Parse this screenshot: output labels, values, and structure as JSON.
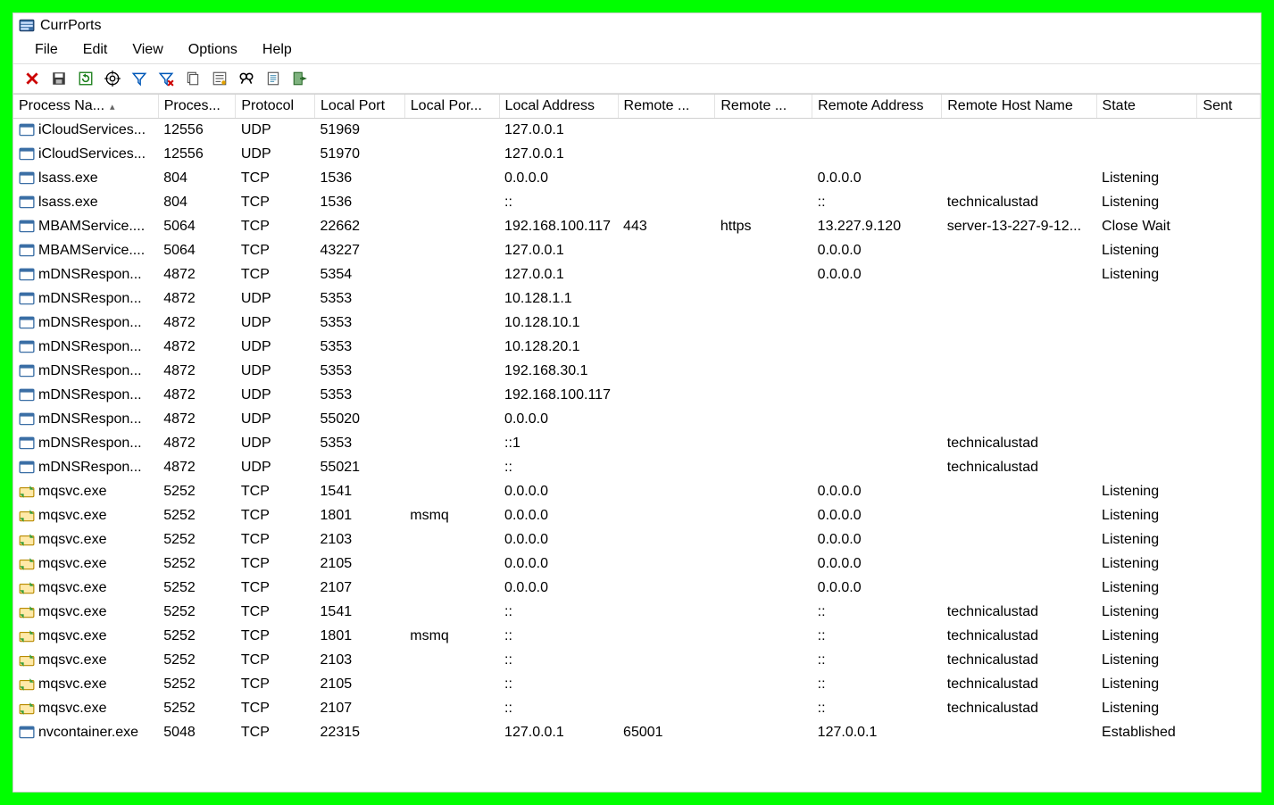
{
  "title": "CurrPorts",
  "menu": {
    "items": [
      "File",
      "Edit",
      "View",
      "Options",
      "Help"
    ]
  },
  "toolbar": {
    "buttons": [
      {
        "name": "close-icon",
        "title": "Close Selected"
      },
      {
        "name": "save-icon",
        "title": "Save"
      },
      {
        "name": "refresh-icon",
        "title": "Refresh"
      },
      {
        "name": "target-icon",
        "title": "Auto Refresh"
      },
      {
        "name": "filter-icon",
        "title": "Filter"
      },
      {
        "name": "filter-clear-icon",
        "title": "Clear Filters"
      },
      {
        "name": "copy-icon",
        "title": "Copy"
      },
      {
        "name": "properties-icon",
        "title": "Properties"
      },
      {
        "name": "find-icon",
        "title": "Find"
      },
      {
        "name": "html-report-icon",
        "title": "HTML Report"
      },
      {
        "name": "exit-icon",
        "title": "Exit"
      }
    ]
  },
  "columns": [
    {
      "key": "proc",
      "label": "Process Na...",
      "cls": "c-proc",
      "sort": true
    },
    {
      "key": "pid",
      "label": "Proces...",
      "cls": "c-pid"
    },
    {
      "key": "proto",
      "label": "Protocol",
      "cls": "c-proto"
    },
    {
      "key": "lport",
      "label": "Local Port",
      "cls": "c-lport"
    },
    {
      "key": "lportn",
      "label": "Local Por...",
      "cls": "c-lportn"
    },
    {
      "key": "laddr",
      "label": "Local Address",
      "cls": "c-laddr"
    },
    {
      "key": "rport",
      "label": "Remote ...",
      "cls": "c-rport"
    },
    {
      "key": "rportn",
      "label": "Remote ...",
      "cls": "c-rportn"
    },
    {
      "key": "raddr",
      "label": "Remote Address",
      "cls": "c-raddr"
    },
    {
      "key": "rhost",
      "label": "Remote Host Name",
      "cls": "c-rhost"
    },
    {
      "key": "state",
      "label": "State",
      "cls": "c-state"
    },
    {
      "key": "sent",
      "label": "Sent",
      "cls": "c-sent"
    }
  ],
  "rows": [
    {
      "icon": "app",
      "proc": "iCloudServices...",
      "pid": "12556",
      "proto": "UDP",
      "lport": "51969",
      "lportn": "",
      "laddr": "127.0.0.1",
      "rport": "",
      "rportn": "",
      "raddr": "",
      "rhost": "",
      "state": "",
      "sent": ""
    },
    {
      "icon": "app",
      "proc": "iCloudServices...",
      "pid": "12556",
      "proto": "UDP",
      "lport": "51970",
      "lportn": "",
      "laddr": "127.0.0.1",
      "rport": "",
      "rportn": "",
      "raddr": "",
      "rhost": "",
      "state": "",
      "sent": ""
    },
    {
      "icon": "app",
      "proc": "lsass.exe",
      "pid": "804",
      "proto": "TCP",
      "lport": "1536",
      "lportn": "",
      "laddr": "0.0.0.0",
      "rport": "",
      "rportn": "",
      "raddr": "0.0.0.0",
      "rhost": "",
      "state": "Listening",
      "sent": ""
    },
    {
      "icon": "app",
      "proc": "lsass.exe",
      "pid": "804",
      "proto": "TCP",
      "lport": "1536",
      "lportn": "",
      "laddr": "::",
      "rport": "",
      "rportn": "",
      "raddr": "::",
      "rhost": "technicalustad",
      "state": "Listening",
      "sent": ""
    },
    {
      "icon": "app",
      "proc": "MBAMService....",
      "pid": "5064",
      "proto": "TCP",
      "lport": "22662",
      "lportn": "",
      "laddr": "192.168.100.117",
      "rport": "443",
      "rportn": "https",
      "raddr": "13.227.9.120",
      "rhost": "server-13-227-9-12...",
      "state": "Close Wait",
      "sent": ""
    },
    {
      "icon": "app",
      "proc": "MBAMService....",
      "pid": "5064",
      "proto": "TCP",
      "lport": "43227",
      "lportn": "",
      "laddr": "127.0.0.1",
      "rport": "",
      "rportn": "",
      "raddr": "0.0.0.0",
      "rhost": "",
      "state": "Listening",
      "sent": ""
    },
    {
      "icon": "app",
      "proc": "mDNSRespon...",
      "pid": "4872",
      "proto": "TCP",
      "lport": "5354",
      "lportn": "",
      "laddr": "127.0.0.1",
      "rport": "",
      "rportn": "",
      "raddr": "0.0.0.0",
      "rhost": "",
      "state": "Listening",
      "sent": ""
    },
    {
      "icon": "app",
      "proc": "mDNSRespon...",
      "pid": "4872",
      "proto": "UDP",
      "lport": "5353",
      "lportn": "",
      "laddr": "10.128.1.1",
      "rport": "",
      "rportn": "",
      "raddr": "",
      "rhost": "",
      "state": "",
      "sent": ""
    },
    {
      "icon": "app",
      "proc": "mDNSRespon...",
      "pid": "4872",
      "proto": "UDP",
      "lport": "5353",
      "lportn": "",
      "laddr": "10.128.10.1",
      "rport": "",
      "rportn": "",
      "raddr": "",
      "rhost": "",
      "state": "",
      "sent": ""
    },
    {
      "icon": "app",
      "proc": "mDNSRespon...",
      "pid": "4872",
      "proto": "UDP",
      "lport": "5353",
      "lportn": "",
      "laddr": "10.128.20.1",
      "rport": "",
      "rportn": "",
      "raddr": "",
      "rhost": "",
      "state": "",
      "sent": ""
    },
    {
      "icon": "app",
      "proc": "mDNSRespon...",
      "pid": "4872",
      "proto": "UDP",
      "lport": "5353",
      "lportn": "",
      "laddr": "192.168.30.1",
      "rport": "",
      "rportn": "",
      "raddr": "",
      "rhost": "",
      "state": "",
      "sent": ""
    },
    {
      "icon": "app",
      "proc": "mDNSRespon...",
      "pid": "4872",
      "proto": "UDP",
      "lport": "5353",
      "lportn": "",
      "laddr": "192.168.100.117",
      "rport": "",
      "rportn": "",
      "raddr": "",
      "rhost": "",
      "state": "",
      "sent": ""
    },
    {
      "icon": "app",
      "proc": "mDNSRespon...",
      "pid": "4872",
      "proto": "UDP",
      "lport": "55020",
      "lportn": "",
      "laddr": "0.0.0.0",
      "rport": "",
      "rportn": "",
      "raddr": "",
      "rhost": "",
      "state": "",
      "sent": ""
    },
    {
      "icon": "app",
      "proc": "mDNSRespon...",
      "pid": "4872",
      "proto": "UDP",
      "lport": "5353",
      "lportn": "",
      "laddr": "::1",
      "rport": "",
      "rportn": "",
      "raddr": "",
      "rhost": "technicalustad",
      "state": "",
      "sent": ""
    },
    {
      "icon": "app",
      "proc": "mDNSRespon...",
      "pid": "4872",
      "proto": "UDP",
      "lport": "55021",
      "lportn": "",
      "laddr": "::",
      "rport": "",
      "rportn": "",
      "raddr": "",
      "rhost": "technicalustad",
      "state": "",
      "sent": ""
    },
    {
      "icon": "svc",
      "proc": "mqsvc.exe",
      "pid": "5252",
      "proto": "TCP",
      "lport": "1541",
      "lportn": "",
      "laddr": "0.0.0.0",
      "rport": "",
      "rportn": "",
      "raddr": "0.0.0.0",
      "rhost": "",
      "state": "Listening",
      "sent": ""
    },
    {
      "icon": "svc",
      "proc": "mqsvc.exe",
      "pid": "5252",
      "proto": "TCP",
      "lport": "1801",
      "lportn": "msmq",
      "laddr": "0.0.0.0",
      "rport": "",
      "rportn": "",
      "raddr": "0.0.0.0",
      "rhost": "",
      "state": "Listening",
      "sent": ""
    },
    {
      "icon": "svc",
      "proc": "mqsvc.exe",
      "pid": "5252",
      "proto": "TCP",
      "lport": "2103",
      "lportn": "",
      "laddr": "0.0.0.0",
      "rport": "",
      "rportn": "",
      "raddr": "0.0.0.0",
      "rhost": "",
      "state": "Listening",
      "sent": ""
    },
    {
      "icon": "svc",
      "proc": "mqsvc.exe",
      "pid": "5252",
      "proto": "TCP",
      "lport": "2105",
      "lportn": "",
      "laddr": "0.0.0.0",
      "rport": "",
      "rportn": "",
      "raddr": "0.0.0.0",
      "rhost": "",
      "state": "Listening",
      "sent": ""
    },
    {
      "icon": "svc",
      "proc": "mqsvc.exe",
      "pid": "5252",
      "proto": "TCP",
      "lport": "2107",
      "lportn": "",
      "laddr": "0.0.0.0",
      "rport": "",
      "rportn": "",
      "raddr": "0.0.0.0",
      "rhost": "",
      "state": "Listening",
      "sent": ""
    },
    {
      "icon": "svc",
      "proc": "mqsvc.exe",
      "pid": "5252",
      "proto": "TCP",
      "lport": "1541",
      "lportn": "",
      "laddr": "::",
      "rport": "",
      "rportn": "",
      "raddr": "::",
      "rhost": "technicalustad",
      "state": "Listening",
      "sent": ""
    },
    {
      "icon": "svc",
      "proc": "mqsvc.exe",
      "pid": "5252",
      "proto": "TCP",
      "lport": "1801",
      "lportn": "msmq",
      "laddr": "::",
      "rport": "",
      "rportn": "",
      "raddr": "::",
      "rhost": "technicalustad",
      "state": "Listening",
      "sent": ""
    },
    {
      "icon": "svc",
      "proc": "mqsvc.exe",
      "pid": "5252",
      "proto": "TCP",
      "lport": "2103",
      "lportn": "",
      "laddr": "::",
      "rport": "",
      "rportn": "",
      "raddr": "::",
      "rhost": "technicalustad",
      "state": "Listening",
      "sent": ""
    },
    {
      "icon": "svc",
      "proc": "mqsvc.exe",
      "pid": "5252",
      "proto": "TCP",
      "lport": "2105",
      "lportn": "",
      "laddr": "::",
      "rport": "",
      "rportn": "",
      "raddr": "::",
      "rhost": "technicalustad",
      "state": "Listening",
      "sent": ""
    },
    {
      "icon": "svc",
      "proc": "mqsvc.exe",
      "pid": "5252",
      "proto": "TCP",
      "lport": "2107",
      "lportn": "",
      "laddr": "::",
      "rport": "",
      "rportn": "",
      "raddr": "::",
      "rhost": "technicalustad",
      "state": "Listening",
      "sent": ""
    },
    {
      "icon": "app",
      "proc": "nvcontainer.exe",
      "pid": "5048",
      "proto": "TCP",
      "lport": "22315",
      "lportn": "",
      "laddr": "127.0.0.1",
      "rport": "65001",
      "rportn": "",
      "raddr": "127.0.0.1",
      "rhost": "",
      "state": "Established",
      "sent": ""
    }
  ]
}
